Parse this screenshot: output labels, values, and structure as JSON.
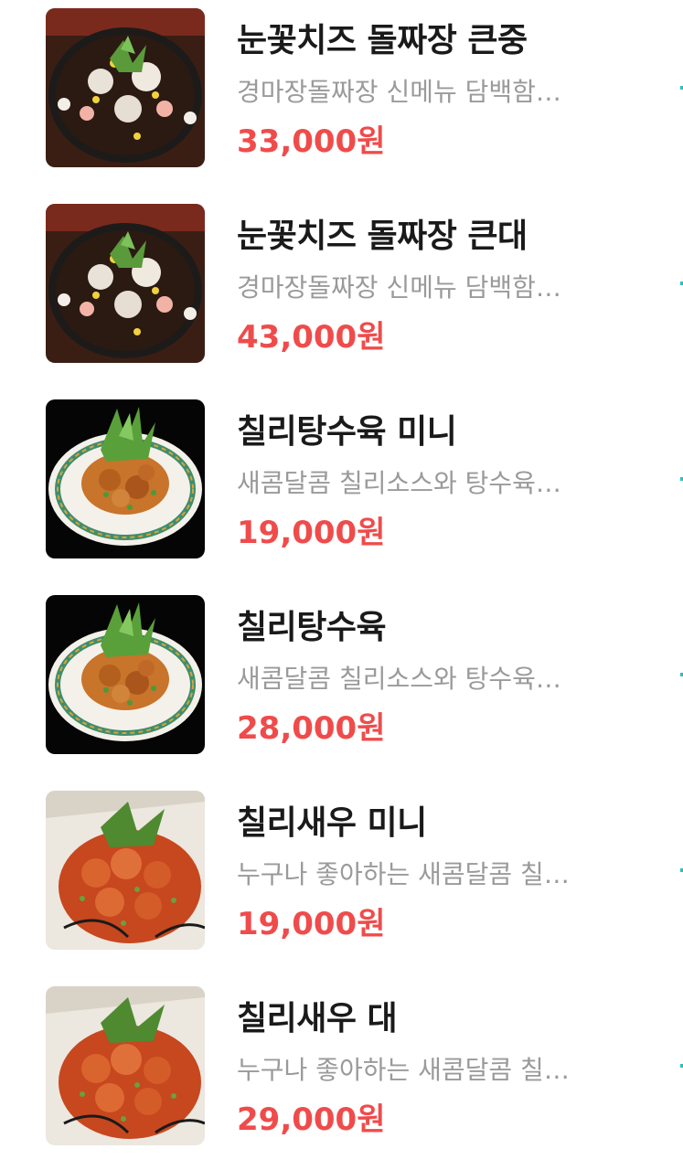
{
  "menu": {
    "items": [
      {
        "name": "눈꽃치즈 돌짜장 큰중",
        "description": "경마장돌짜장 신메뉴 담백함…",
        "price": "33,000원",
        "image_icon": "jjajang-cheese-photo"
      },
      {
        "name": "눈꽃치즈 돌짜장 큰대",
        "description": "경마장돌짜장 신메뉴 담백함…",
        "price": "43,000원",
        "image_icon": "jjajang-cheese-photo"
      },
      {
        "name": "칠리탕수육 미니",
        "description": "새콤달콤 칠리소스와 탕수육…",
        "price": "19,000원",
        "image_icon": "chili-tangsuyuk-photo"
      },
      {
        "name": "칠리탕수육",
        "description": "새콤달콤 칠리소스와 탕수육…",
        "price": "28,000원",
        "image_icon": "chili-tangsuyuk-photo"
      },
      {
        "name": "칠리새우 미니",
        "description": "누구나 좋아하는 새콤달콤 칠…",
        "price": "19,000원",
        "image_icon": "chili-shrimp-photo"
      },
      {
        "name": "칠리새우 대",
        "description": "누구나 좋아하는 새콤달콤 칠…",
        "price": "29,000원",
        "image_icon": "chili-shrimp-photo"
      }
    ]
  },
  "colors": {
    "name": "#1a1a1a",
    "description": "#9a9a9a",
    "price": "#f04b4b",
    "accent": "#2bc1bc"
  }
}
